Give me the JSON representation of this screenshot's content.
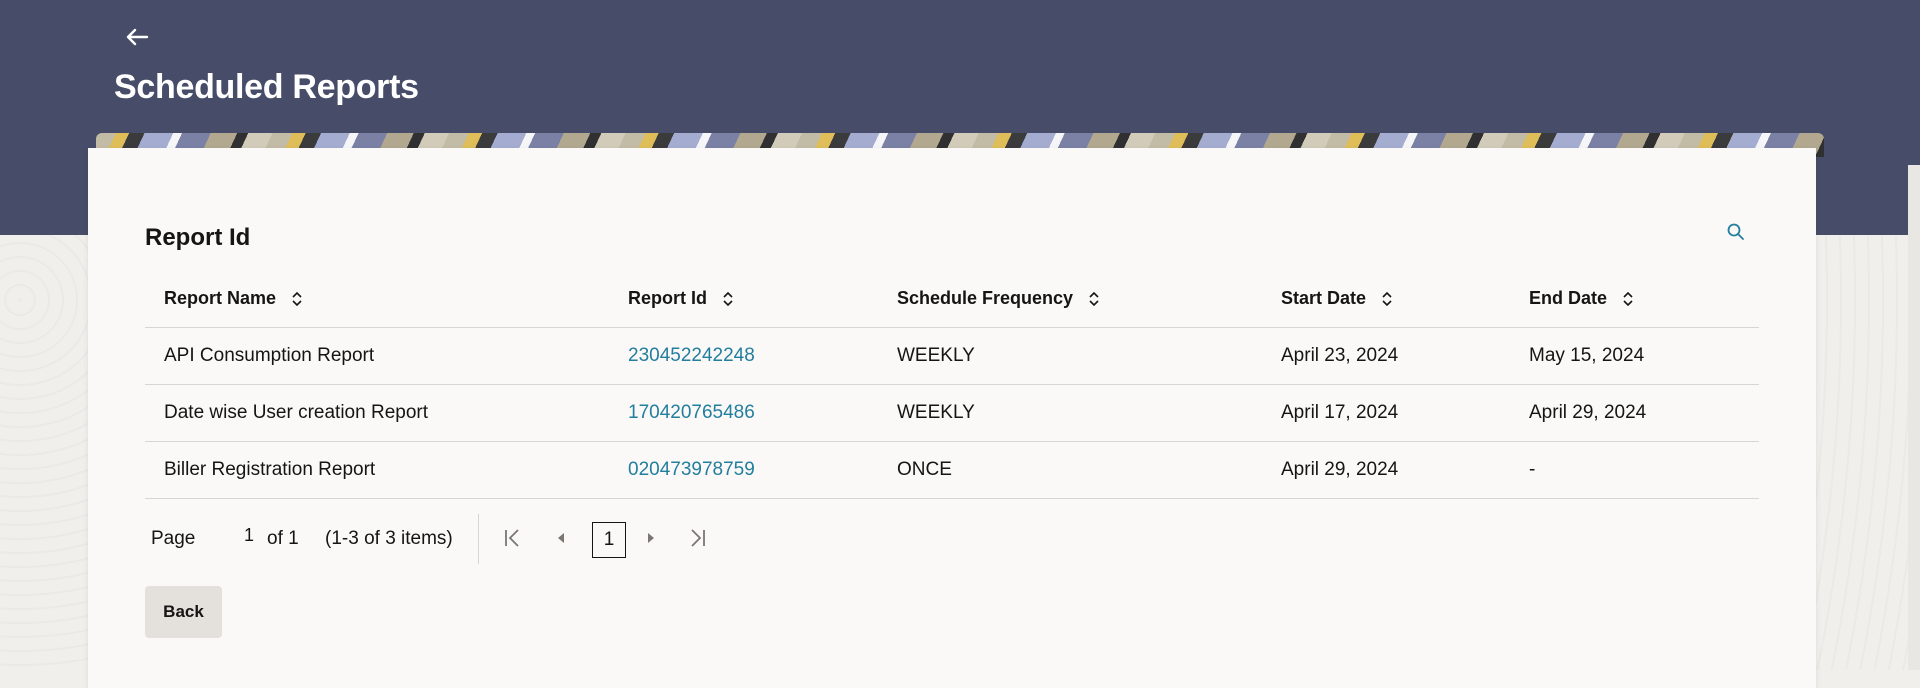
{
  "header": {
    "title": "Scheduled Reports"
  },
  "section": {
    "title": "Report Id"
  },
  "table": {
    "columns": [
      "Report Name",
      "Report Id",
      "Schedule Frequency",
      "Start Date",
      "End Date"
    ],
    "rows": [
      {
        "report_name": "API Consumption Report",
        "report_id": "230452242248",
        "frequency": "WEEKLY",
        "start_date": "April 23, 2024",
        "end_date": "May 15, 2024"
      },
      {
        "report_name": "Date wise User creation Report",
        "report_id": "170420765486",
        "frequency": "WEEKLY",
        "start_date": "April 17, 2024",
        "end_date": "April 29, 2024"
      },
      {
        "report_name": "Biller Registration Report",
        "report_id": "020473978759",
        "frequency": "ONCE",
        "start_date": "April 29, 2024",
        "end_date": "-"
      }
    ]
  },
  "pagination": {
    "page_label": "Page",
    "current_page": "1",
    "of_label": "of 1",
    "items_label": "(1-3 of 3 items)",
    "page_button": "1"
  },
  "actions": {
    "back_label": "Back"
  },
  "colors": {
    "header_bg": "#474c69",
    "link": "#227e9e",
    "card_bg": "#fbf9f8"
  },
  "icons": [
    "back-arrow-icon",
    "search-icon",
    "sort-icon",
    "first-page-icon",
    "previous-page-icon",
    "next-page-icon",
    "last-page-icon"
  ]
}
